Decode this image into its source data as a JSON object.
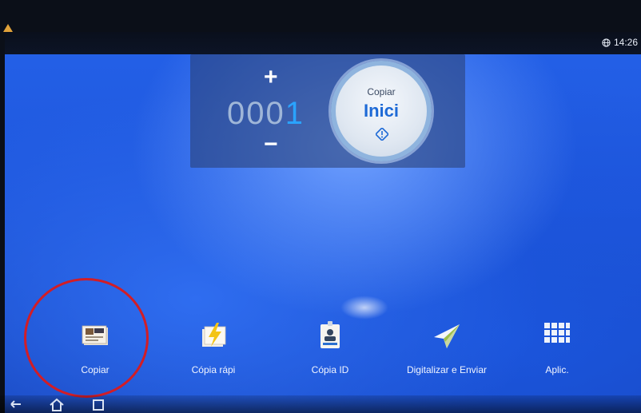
{
  "status_bar": {
    "time": "14:26",
    "icons": [
      "warning-icon",
      "globe-icon"
    ]
  },
  "counter": {
    "plus_symbol": "+",
    "minus_symbol": "−",
    "value_prefix": "000",
    "value_last_digit": "1"
  },
  "start_button": {
    "sub_label": "Copiar",
    "main_label": "Inici",
    "icon": "diamond-start-icon"
  },
  "dock": {
    "items": [
      {
        "label": "Copiar",
        "icon": "copy-icon"
      },
      {
        "label": "Cópia rápi",
        "icon": "quick-copy-icon"
      },
      {
        "label": "Cópia ID",
        "icon": "id-copy-icon"
      },
      {
        "label": "Digitalizar e Enviar",
        "icon": "paper-plane-icon"
      },
      {
        "label": "Aplic.",
        "icon": "apps-grid-icon"
      }
    ],
    "highlighted_item": "Copiar"
  },
  "nav_bar": {
    "icons": [
      "back-icon",
      "home-icon",
      "recent-apps-icon"
    ]
  },
  "colors": {
    "accent": "#2aa3ff",
    "highlight_ring": "#d21d26",
    "start_text": "#1e6ad6"
  }
}
